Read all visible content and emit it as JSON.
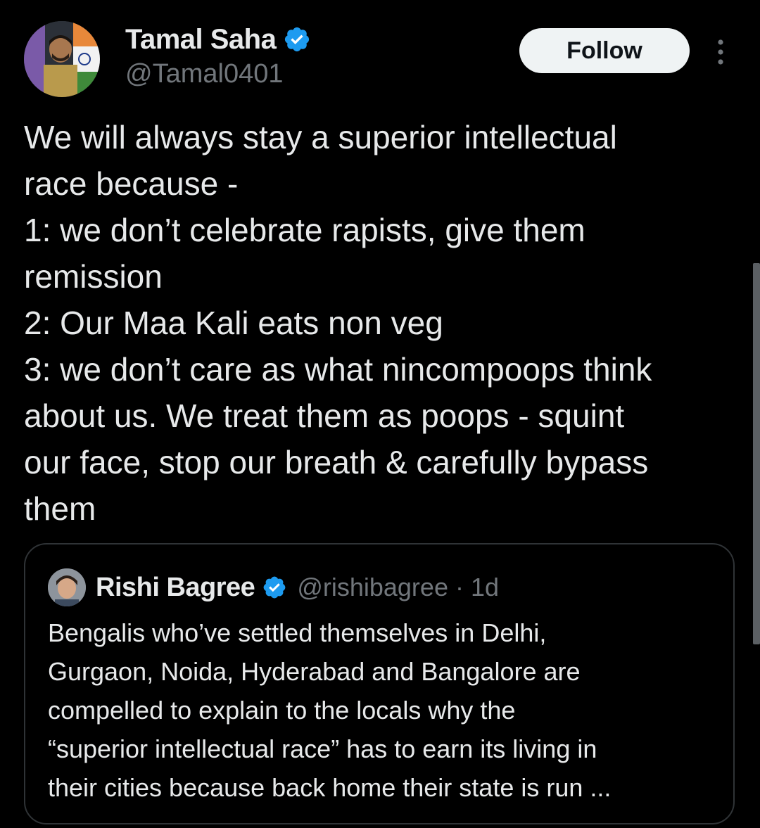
{
  "tweet": {
    "author": {
      "name": "Tamal Saha",
      "handle": "@Tamal0401",
      "verified": true
    },
    "follow_label": "Follow",
    "more_icon": "more-vertical-icon",
    "lines": [
      "We will always stay a superior intellectual",
      "race because -",
      "1: we don’t celebrate rapists, give them",
      "remission",
      "2: Our Maa Kali eats non veg",
      "3: we don’t care as what nincompoops think",
      "about us. We treat them as poops - squint",
      "our face, stop our breath & carefully bypass",
      "them"
    ]
  },
  "quoted_tweet": {
    "author": {
      "name": "Rishi Bagree",
      "handle": "@rishibagree",
      "verified": true
    },
    "separator": "·",
    "time": "1d",
    "lines": [
      "Bengalis who’ve settled themselves in Delhi,",
      "Gurgaon, Noida, Hyderabad and Bangalore are",
      "compelled to explain to the locals why the",
      "“superior intellectual race” has to earn its living in",
      "their cities because back home their state is run ..."
    ]
  },
  "colors": {
    "background": "#000000",
    "text": "#e7e9ea",
    "secondary_text": "#71767b",
    "verified_badge": "#1d9bf0",
    "border": "#2f3336",
    "follow_button_bg": "#eff3f4"
  }
}
